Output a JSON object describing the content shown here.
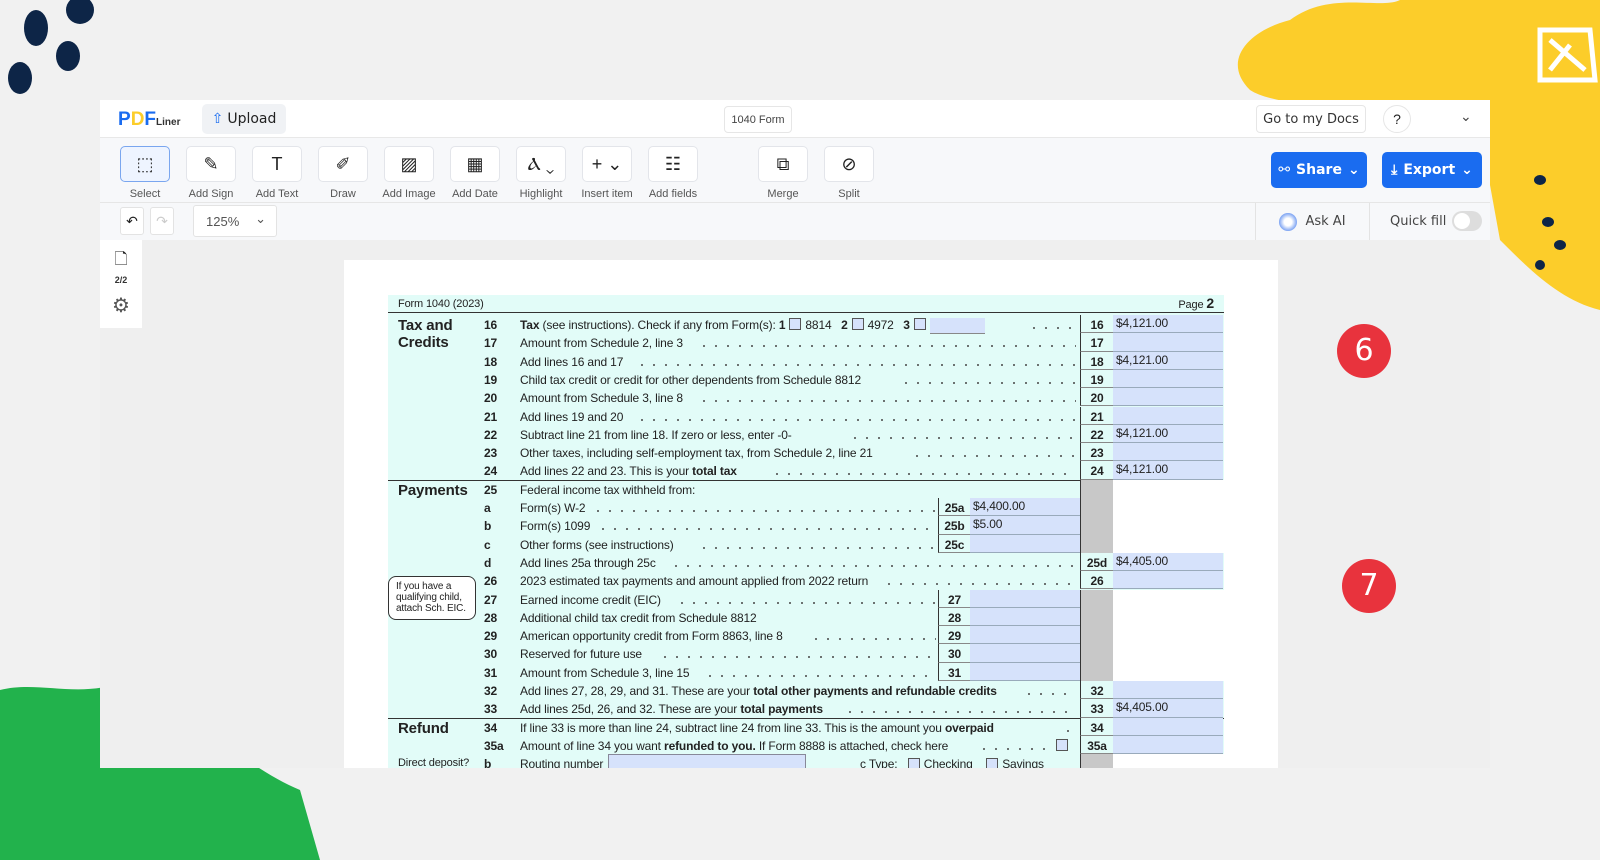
{
  "header": {
    "logo": "PDFLiner",
    "upload_label": "Upload",
    "doc_title": "1040 Form",
    "go_docs_label": "Go to my Docs",
    "help_label": "?"
  },
  "toolbar": {
    "tools": [
      {
        "label": "Select",
        "icon": "select-icon"
      },
      {
        "label": "Add Sign",
        "icon": "sign-icon"
      },
      {
        "label": "Add Text",
        "icon": "text-icon"
      },
      {
        "label": "Draw",
        "icon": "pen-icon"
      },
      {
        "label": "Add Image",
        "icon": "image-icon"
      },
      {
        "label": "Add Date",
        "icon": "calendar-icon"
      },
      {
        "label": "Highlight",
        "icon": "highlight-icon"
      },
      {
        "label": "Insert item",
        "icon": "plus-icon"
      },
      {
        "label": "Add fields",
        "icon": "fields-icon"
      },
      {
        "label": "Merge",
        "icon": "merge-icon"
      },
      {
        "label": "Split",
        "icon": "split-icon"
      }
    ],
    "share_label": "Share",
    "export_label": "Export",
    "zoom": "125%",
    "ask_ai_label": "Ask AI",
    "quick_fill_label": "Quick fill",
    "quick_fill_on": false
  },
  "sidebar": {
    "page_count": "2/2"
  },
  "form": {
    "header_left": "Form 1040 (2023)",
    "header_page": "Page",
    "header_page_num": "2",
    "sections": {
      "tax": "Tax and Credits",
      "payments": "Payments",
      "refund": "Refund",
      "direct_deposit": "Direct deposit?"
    },
    "eic_note": "If you have a qualifying child, attach Sch. EIC.",
    "line16_checks": {
      "c1": "1",
      "f1": "8814",
      "c2": "2",
      "f2": "4972",
      "c3": "3"
    },
    "routing": {
      "num": "b",
      "label": "Routing number",
      "type_label": "c Type:",
      "checking": "Checking",
      "savings": "Savings"
    },
    "rows": [
      {
        "num": "16",
        "parts": [
          {
            "t": "Tax",
            "b": true
          },
          {
            "t": " (see instructions). Check if any from Form(s):"
          }
        ],
        "box": "16",
        "value": "$4,121.00",
        "checks": true
      },
      {
        "num": "17",
        "parts": [
          {
            "t": "Amount from Schedule 2, line 3"
          }
        ],
        "box": "17",
        "value": ""
      },
      {
        "num": "18",
        "parts": [
          {
            "t": "Add lines 16 and 17"
          }
        ],
        "box": "18",
        "value": "$4,121.00"
      },
      {
        "num": "19",
        "parts": [
          {
            "t": "Child tax credit or credit for other dependents from Schedule 8812"
          }
        ],
        "box": "19",
        "value": ""
      },
      {
        "num": "20",
        "parts": [
          {
            "t": "Amount from Schedule 3, line 8"
          }
        ],
        "box": "20",
        "value": ""
      },
      {
        "num": "21",
        "parts": [
          {
            "t": "Add lines 19 and 20"
          }
        ],
        "box": "21",
        "value": ""
      },
      {
        "num": "22",
        "parts": [
          {
            "t": "Subtract line 21 from line 18. If zero or less, enter -0-"
          }
        ],
        "box": "22",
        "value": "$4,121.00"
      },
      {
        "num": "23",
        "parts": [
          {
            "t": "Other taxes, including self-employment tax, from Schedule 2, line 21"
          }
        ],
        "box": "23",
        "value": ""
      },
      {
        "num": "24",
        "parts": [
          {
            "t": "Add lines 22 and 23. This is your "
          },
          {
            "t": "total tax",
            "b": true
          }
        ],
        "box": "24",
        "value": "$4,121.00"
      },
      {
        "num": "25",
        "parts": [
          {
            "t": "Federal income tax withheld from:"
          }
        ],
        "nodots": true,
        "gray": true
      },
      {
        "num": "a",
        "parts": [
          {
            "t": "Form(s) W-2"
          }
        ],
        "sub": "25a",
        "subval": "$4,400.00",
        "gray": true
      },
      {
        "num": "b",
        "parts": [
          {
            "t": "Form(s) 1099"
          }
        ],
        "sub": "25b",
        "subval": "$5.00",
        "gray": true
      },
      {
        "num": "c",
        "parts": [
          {
            "t": "Other forms (see instructions)"
          }
        ],
        "sub": "25c",
        "subval": "",
        "gray": true
      },
      {
        "num": "d",
        "parts": [
          {
            "t": "Add lines 25a through 25c"
          }
        ],
        "box": "25d",
        "value": "$4,405.00"
      },
      {
        "num": "26",
        "parts": [
          {
            "t": "2023 estimated tax payments and amount applied from 2022 return"
          }
        ],
        "box": "26",
        "value": ""
      },
      {
        "num": "27",
        "parts": [
          {
            "t": "Earned income credit (EIC)"
          }
        ],
        "sub": "27",
        "subval": "",
        "gray": true
      },
      {
        "num": "28",
        "parts": [
          {
            "t": "Additional child tax credit from Schedule 8812"
          }
        ],
        "sub": "28",
        "subval": "",
        "gray": true,
        "nodots": true
      },
      {
        "num": "29",
        "parts": [
          {
            "t": "American opportunity credit from Form 8863, line 8"
          }
        ],
        "sub": "29",
        "subval": "",
        "gray": true
      },
      {
        "num": "30",
        "parts": [
          {
            "t": "Reserved for future use"
          }
        ],
        "sub": "30",
        "subval": "",
        "gray": true
      },
      {
        "num": "31",
        "parts": [
          {
            "t": "Amount from Schedule 3, line 15"
          }
        ],
        "sub": "31",
        "subval": "",
        "gray": true
      },
      {
        "num": "32",
        "parts": [
          {
            "t": "Add lines 27, 28, 29, and 31. These are your "
          },
          {
            "t": "total other payments and refundable credits",
            "b": true
          }
        ],
        "box": "32",
        "value": ""
      },
      {
        "num": "33",
        "parts": [
          {
            "t": "Add lines 25d, 26, and 32. These are your "
          },
          {
            "t": "total payments",
            "b": true
          }
        ],
        "box": "33",
        "value": "$4,405.00"
      },
      {
        "num": "34",
        "parts": [
          {
            "t": "If line 33 is more than line 24, subtract line 24 from line 33. This is the amount you "
          },
          {
            "t": "overpaid",
            "b": true
          }
        ],
        "box": "34",
        "value": ""
      },
      {
        "num": "35a",
        "parts": [
          {
            "t": "Amount of line 34 you want "
          },
          {
            "t": "refunded to you.",
            "b": true
          },
          {
            "t": " If Form 8888 is attached, check here"
          }
        ],
        "box": "35a",
        "value": "",
        "checkbox": true
      }
    ]
  },
  "callouts": [
    {
      "label": "6",
      "target": "line 24 total tax"
    },
    {
      "label": "7",
      "target": "line 33 total payments"
    }
  ],
  "colors": {
    "accent": "#1a6cf0",
    "callout": "#e8333d",
    "yellow": "#fccd2a",
    "green": "#22b24c",
    "navy": "#0d2547",
    "form_bg": "#e2fcf8",
    "field": "#d6e2fb"
  }
}
